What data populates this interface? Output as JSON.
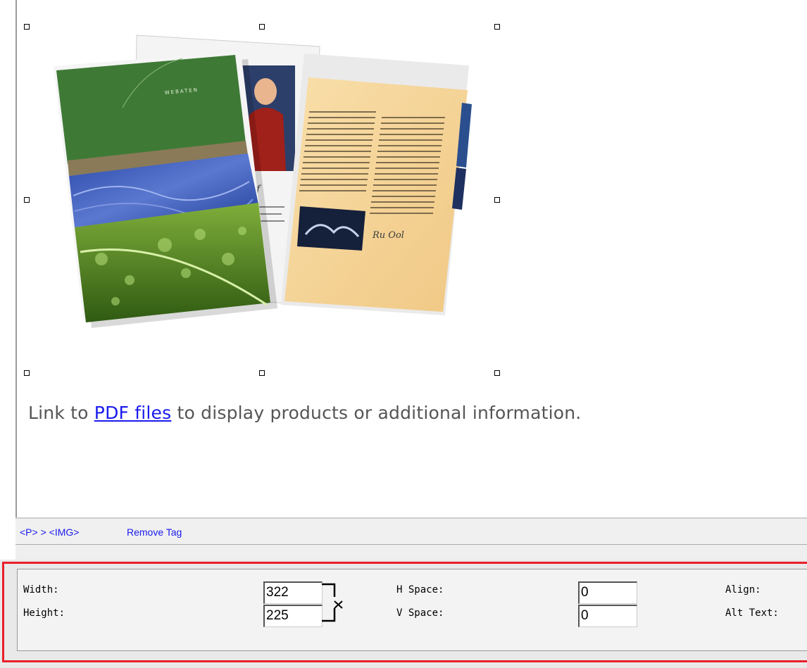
{
  "body_text": {
    "before_link": "Link to ",
    "link": "PDF files",
    "after_link": " to display products or additional information."
  },
  "tag_bar": {
    "path": "<P> > <IMG>",
    "remove_tag": "Remove Tag"
  },
  "properties": {
    "width_label": "Width:",
    "width_value": "322",
    "height_label": "Height:",
    "height_value": "225",
    "hspace_label": "H Space:",
    "hspace_value": "0",
    "vspace_label": "V Space:",
    "vspace_value": "0",
    "align_label": "Align:",
    "alt_label": "Alt Text:"
  },
  "colors": {
    "highlight": "#e8202a",
    "link": "#1a1aee",
    "brochure_green": "#3e7a36",
    "brochure_blue": "#3b5ab5",
    "page_beige": "#f7d9a0"
  }
}
